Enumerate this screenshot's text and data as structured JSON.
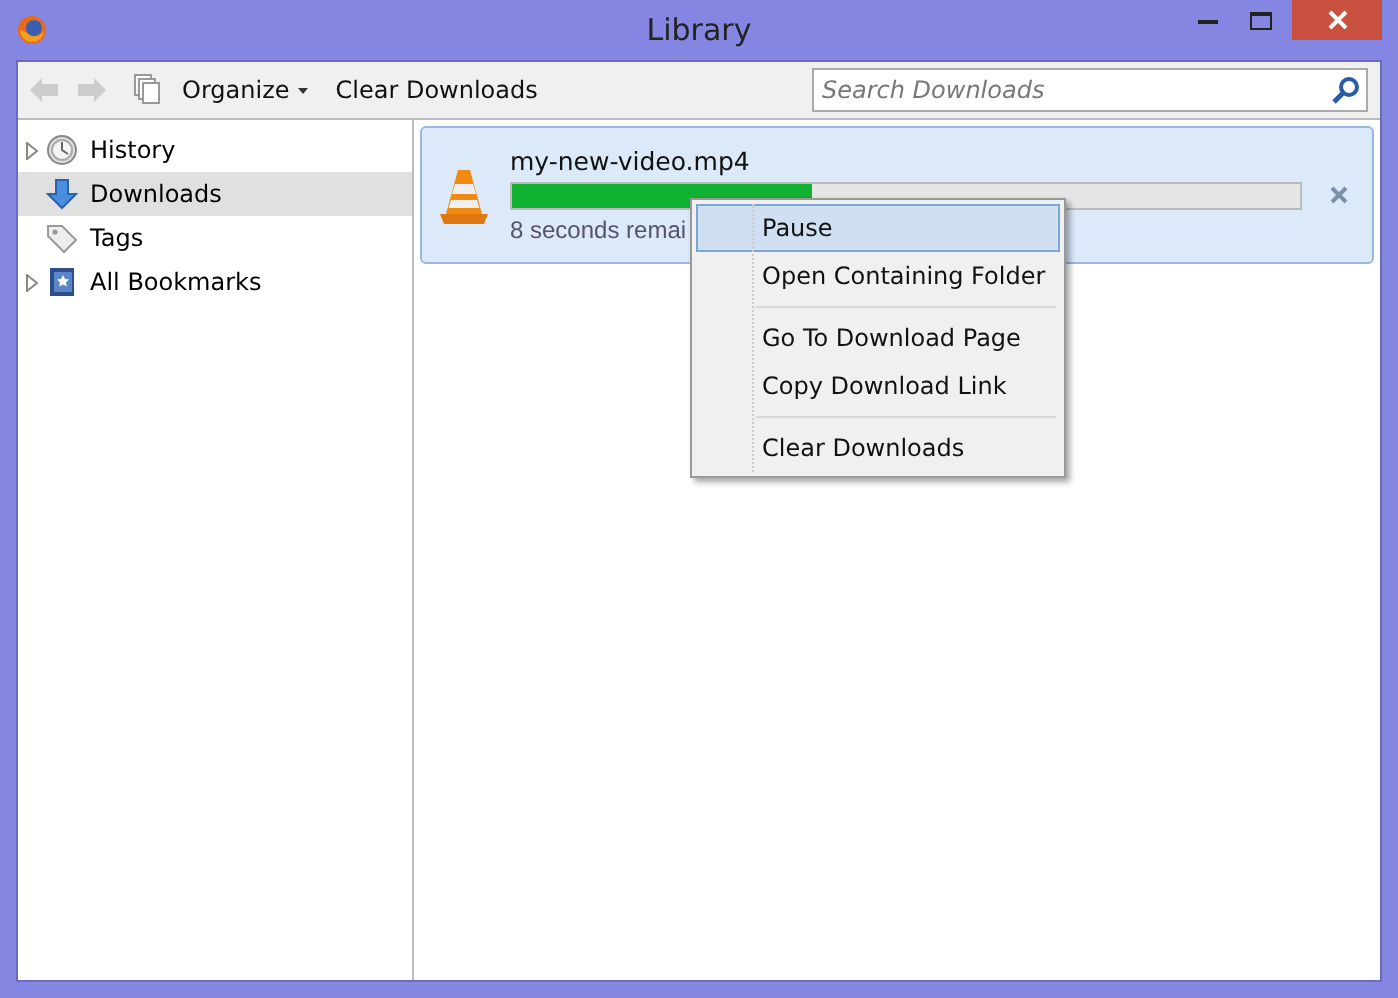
{
  "window": {
    "title": "Library"
  },
  "toolbar": {
    "organize": "Organize",
    "clear": "Clear Downloads",
    "search": {
      "placeholder": "Search Downloads"
    }
  },
  "sidebar": {
    "items": [
      {
        "label": "History",
        "kind": "folder",
        "expanded": false,
        "selected": false
      },
      {
        "label": "Downloads",
        "kind": "leaf",
        "selected": true
      },
      {
        "label": "Tags",
        "kind": "leaf",
        "selected": false
      },
      {
        "label": "All Bookmarks",
        "kind": "folder",
        "expanded": false,
        "selected": false
      }
    ]
  },
  "downloads": [
    {
      "name": "my-new-video.mp4",
      "level": 0.38,
      "status": "8 seconds remai",
      "selected": true
    }
  ],
  "context_menu": {
    "groups": [
      [
        {
          "label": "Pause",
          "selected": true
        },
        {
          "label": "Open Containing Folder",
          "selected": false
        }
      ],
      [
        {
          "label": "Go To Download Page",
          "selected": false
        },
        {
          "label": "Copy Download Link",
          "selected": false
        }
      ],
      [
        {
          "label": "Clear Downloads",
          "selected": false
        }
      ]
    ]
  }
}
